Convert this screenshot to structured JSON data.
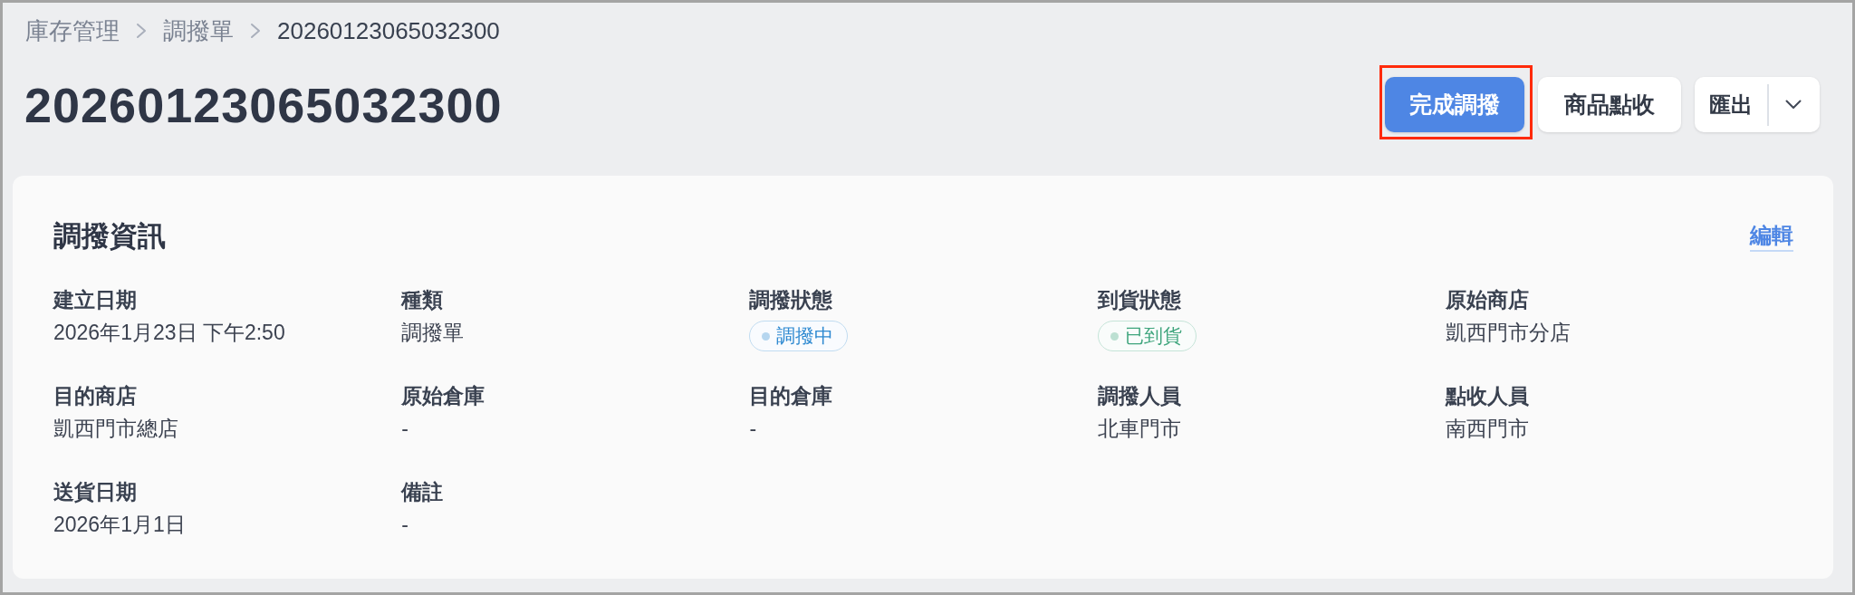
{
  "breadcrumb": [
    {
      "label": "庫存管理",
      "current": false
    },
    {
      "label": "調撥單",
      "current": false
    },
    {
      "label": "20260123065032300",
      "current": true
    }
  ],
  "page_title": "20260123065032300",
  "actions": [
    {
      "kind": "primary",
      "label": "完成調撥",
      "highlighted": true
    },
    {
      "kind": "secondary",
      "label": "商品點收",
      "highlighted": false
    },
    {
      "kind": "split",
      "label": "匯出",
      "highlighted": false
    }
  ],
  "info_card": {
    "title": "調撥資訊",
    "edit_link": "編輯",
    "fields": [
      {
        "kind": "text",
        "label": "建立日期",
        "value": "2026年1月23日 下午2:50"
      },
      {
        "kind": "text",
        "label": "種類",
        "value": "調撥單"
      },
      {
        "kind": "badge",
        "label": "調撥狀態",
        "value": "調撥中",
        "color": "#2f8ad1"
      },
      {
        "kind": "badge",
        "label": "到貨狀態",
        "value": "已到貨",
        "color": "#3fa57d"
      },
      {
        "kind": "text",
        "label": "原始商店",
        "value": "凱西門市分店"
      },
      {
        "kind": "text",
        "label": "目的商店",
        "value": "凱西門市總店"
      },
      {
        "kind": "text",
        "label": "原始倉庫",
        "value": "-"
      },
      {
        "kind": "text",
        "label": "目的倉庫",
        "value": "-"
      },
      {
        "kind": "text",
        "label": "調撥人員",
        "value": "北車門市"
      },
      {
        "kind": "text",
        "label": "點收人員",
        "value": "南西門市"
      },
      {
        "kind": "text",
        "label": "送貨日期",
        "value": "2026年1月1日"
      },
      {
        "kind": "text",
        "label": "備註",
        "value": "-"
      }
    ]
  }
}
